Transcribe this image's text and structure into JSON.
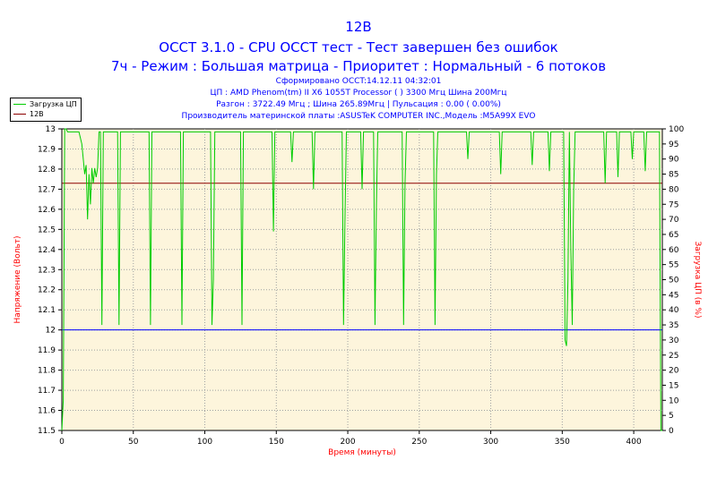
{
  "header": {
    "title": "12В",
    "subtitle1": "OCCT 3.1.0 - CPU OCCT тест - Тест завершен без ошибок",
    "subtitle2": "7ч - Режим : Большая матрица - Приоритет : Нормальный - 6 потоков",
    "info1": "Сформировано OCCT:14.12.11 04:32:01",
    "info2": "ЦП : AMD Phenom(tm) II X6 1055T Processor (  ) 3300 Мгц Шина 200Мгц",
    "info3": "Разгон : 3722.49 Мгц ; Шина 265.89Мгц | Пульсация : 0.00 ( 0.00%)",
    "info4": "Производитель материнской платы :ASUSTeK COMPUTER INC.,Модель :M5A99X EVO"
  },
  "legend": {
    "items": [
      {
        "label": "Загрузка ЦП",
        "color": "#00cc00"
      },
      {
        "label": "12В",
        "color": "#8b0000"
      }
    ]
  },
  "chart_data": {
    "type": "line",
    "xlabel": "Время (минуты)",
    "ylabel_left": "Напряжение (Вольт)",
    "ylabel_right": "Загрузка ЦП (в %)",
    "xlim": [
      0,
      420
    ],
    "ylim_left": [
      11.5,
      13
    ],
    "ylim_right": [
      0,
      100
    ],
    "x_ticks": [
      "0",
      "50",
      "100",
      "150",
      "200",
      "250",
      "300",
      "350",
      "400"
    ],
    "y_left_ticks": [
      "11.5",
      "11.6",
      "11.7",
      "11.8",
      "11.9",
      "12",
      "12.1",
      "12.2",
      "12.3",
      "12.4",
      "12.5",
      "12.6",
      "12.7",
      "12.8",
      "12.9",
      "13"
    ],
    "y_right_ticks": [
      "0",
      "5",
      "10",
      "15",
      "20",
      "25",
      "30",
      "35",
      "40",
      "45",
      "50",
      "55",
      "60",
      "65",
      "70",
      "75",
      "80",
      "85",
      "90",
      "95",
      "100"
    ],
    "grid": true,
    "reference_line_left": 12,
    "series": [
      {
        "name": "12В",
        "axis": "left",
        "color": "#8b0000",
        "x": [
          0,
          420
        ],
        "y": [
          12.73,
          12.73
        ]
      },
      {
        "name": "Загрузка ЦП",
        "axis": "right",
        "color": "#00cc00",
        "x": [
          0,
          1,
          2,
          3,
          4,
          10,
          12,
          14,
          15,
          16,
          17,
          18,
          19,
          20,
          21,
          22,
          23,
          24,
          25,
          26,
          27,
          28,
          29,
          30,
          39,
          40,
          41,
          42,
          61,
          62,
          63,
          64,
          83,
          84,
          85,
          86,
          104,
          105,
          106,
          107,
          108,
          125,
          126,
          127,
          128,
          147,
          148,
          149,
          160,
          161,
          162,
          175,
          176,
          177,
          196,
          197,
          198,
          199,
          209,
          210,
          211,
          218,
          219,
          220,
          221,
          238,
          239,
          240,
          241,
          260,
          261,
          262,
          263,
          283,
          284,
          285,
          306,
          307,
          308,
          328,
          329,
          330,
          340,
          341,
          342,
          351,
          352,
          353,
          354,
          355,
          356,
          357,
          358,
          359,
          360,
          379,
          380,
          381,
          388,
          389,
          390,
          398,
          399,
          400,
          407,
          408,
          409,
          418,
          419,
          420
        ],
        "y": [
          0,
          10,
          100,
          100,
          99,
          99,
          99,
          95,
          90,
          85,
          88,
          70,
          85,
          75,
          87,
          82,
          87,
          84,
          87,
          99,
          99,
          35,
          99,
          99,
          99,
          35,
          99,
          99,
          99,
          35,
          99,
          99,
          99,
          35,
          99,
          99,
          99,
          35,
          50,
          99,
          99,
          99,
          35,
          99,
          99,
          99,
          66,
          99,
          99,
          89,
          99,
          99,
          80,
          99,
          99,
          35,
          70,
          99,
          99,
          80,
          99,
          99,
          35,
          75,
          99,
          99,
          35,
          82,
          99,
          99,
          35,
          85,
          99,
          99,
          90,
          99,
          99,
          85,
          99,
          99,
          88,
          99,
          99,
          86,
          99,
          99,
          30,
          28,
          50,
          99,
          60,
          35,
          80,
          99,
          99,
          99,
          82,
          99,
          99,
          84,
          99,
          99,
          90,
          99,
          99,
          86,
          99,
          99,
          0,
          0
        ]
      }
    ]
  }
}
